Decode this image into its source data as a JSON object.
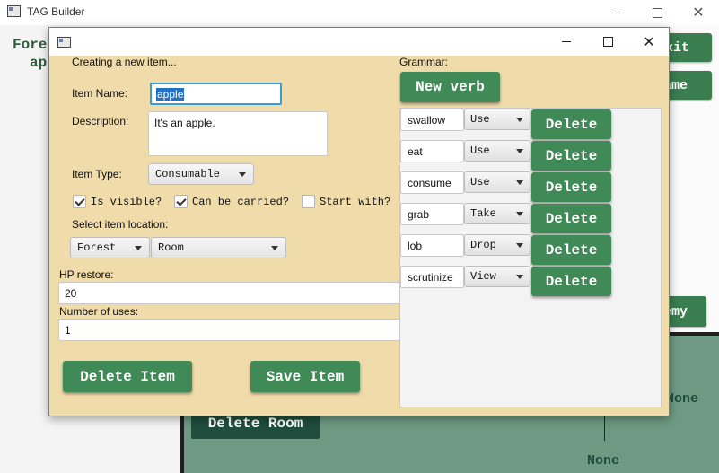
{
  "main": {
    "title": "TAG Builder",
    "left_text_line1": "Fore",
    "left_text_line2": "ap",
    "exit_label": "xit",
    "game_label": "ame",
    "enemy_label": "emy",
    "delete_room_label": "Delete Room",
    "none_label_1": "None",
    "none_label_2": "None"
  },
  "dialog": {
    "heading": "Creating a new item...",
    "item_name_label": "Item Name:",
    "item_name_value": "apple",
    "description_label": "Description:",
    "description_value": "It's an apple.",
    "item_type_label": "Item Type:",
    "item_type_value": "Consumable",
    "checks": {
      "visible_label": "Is visible?",
      "visible_checked": true,
      "carried_label": "Can be carried?",
      "carried_checked": true,
      "start_label": "Start with?",
      "start_checked": false
    },
    "location_label": "Select item location:",
    "location_area_value": "Forest",
    "location_room_value": "Room",
    "hp_label": "HP restore:",
    "hp_value": "20",
    "uses_label": "Number of uses:",
    "uses_value": "1",
    "delete_item_label": "Delete Item",
    "save_item_label": "Save Item",
    "grammar_label": "Grammar:",
    "new_verb_label": "New verb",
    "verbs": [
      {
        "word": "swallow",
        "action": "Use",
        "delete_label": "Delete"
      },
      {
        "word": "eat",
        "action": "Use",
        "delete_label": "Delete"
      },
      {
        "word": "consume",
        "action": "Use",
        "delete_label": "Delete"
      },
      {
        "word": "grab",
        "action": "Take",
        "delete_label": "Delete"
      },
      {
        "word": "lob",
        "action": "Drop",
        "delete_label": "Delete"
      },
      {
        "word": "scrutinize",
        "action": "View",
        "delete_label": "Delete"
      }
    ]
  },
  "colors": {
    "dialog_bg": "#f0dcaa",
    "green_button": "#3f8a56",
    "dark_green": "#1f4d3e",
    "selection_blue": "#1f72c8"
  }
}
